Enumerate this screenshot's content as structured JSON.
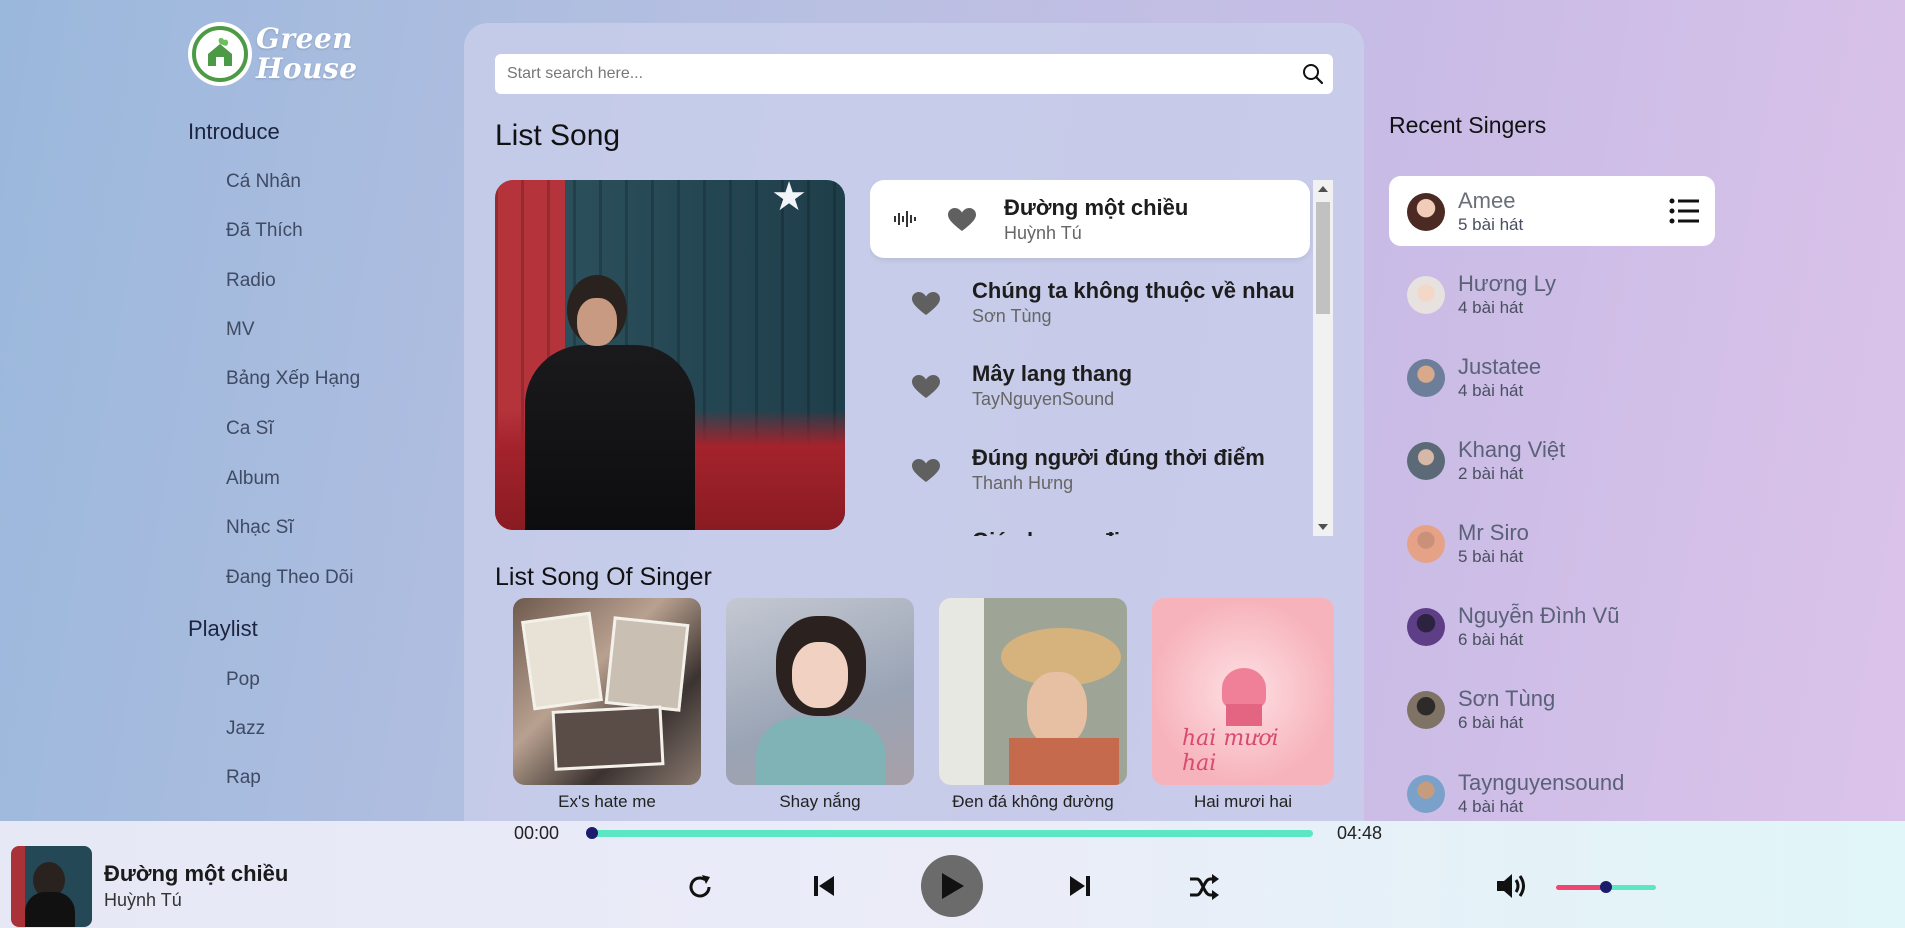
{
  "brand": {
    "line1": "Green",
    "line2": "House"
  },
  "sidebar": {
    "introduce_title": "Introduce",
    "introduce_items": [
      "Cá Nhân",
      "Đã Thích",
      "Radio",
      "MV",
      "Bảng Xếp Hạng",
      "Ca Sĩ",
      "Album",
      "Nhạc Sĩ",
      "Đang Theo Dõi"
    ],
    "playlist_title": "Playlist",
    "playlist_items": [
      "Pop",
      "Jazz",
      "Rap"
    ]
  },
  "search": {
    "placeholder": "Start search here...",
    "icon": "search-icon"
  },
  "list_song": {
    "title": "List Song",
    "songs": [
      {
        "title": "Đường một chiều",
        "artist": "Huỳnh Tú",
        "playing": true
      },
      {
        "title": "Chúng ta không thuộc về nhau",
        "artist": "Sơn Tùng"
      },
      {
        "title": "Mây lang thang",
        "artist": "TayNguyenSound"
      },
      {
        "title": "Đúng người đúng thời điểm",
        "artist": "Thanh Hưng"
      },
      {
        "title": "Giá như em đi",
        "artist": ""
      }
    ]
  },
  "list_song_of_singer": {
    "title": "List Song Of Singer",
    "albums": [
      "Ex's hate me",
      "Shay nắng",
      "Đen đá không đường",
      "Hai mươi hai"
    ]
  },
  "recent_singers": {
    "title": "Recent Singers",
    "singers": [
      {
        "name": "Amee",
        "count": "5 bài hát"
      },
      {
        "name": "Hương Ly",
        "count": "4 bài hát"
      },
      {
        "name": "Justatee",
        "count": "4 bài hát"
      },
      {
        "name": "Khang Việt",
        "count": "2 bài hát"
      },
      {
        "name": "Mr Siro",
        "count": "5 bài hát"
      },
      {
        "name": "Nguyễn Đình Vũ",
        "count": "6 bài hát"
      },
      {
        "name": "Sơn Tùng",
        "count": "6 bài hát"
      },
      {
        "name": "Taynguyensound",
        "count": "4 bài hát"
      }
    ]
  },
  "player": {
    "title": "Đường một chiều",
    "artist": "Huỳnh Tú",
    "current_time": "00:00",
    "duration": "04:48",
    "progress": 0.0,
    "volume": 0.5
  },
  "colors": {
    "accent_teal": "#5ce6c4",
    "accent_pink": "#ef4573",
    "knob": "#1d1b6b",
    "logo_green": "#4c9a46"
  }
}
